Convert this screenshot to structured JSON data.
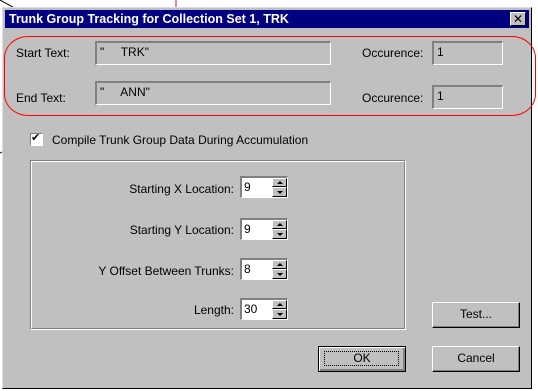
{
  "window": {
    "title": "Trunk Group Tracking for Collection Set 1, TRK",
    "close_symbol": "✕"
  },
  "start": {
    "label": "Start Text:",
    "value": "\"     TRK\"",
    "occurence_label": "Occurence:",
    "occurence_value": "1"
  },
  "end": {
    "label": "End Text:",
    "value": "\"     ANN\"",
    "occurence_label": "Occurence:",
    "occurence_value": "1"
  },
  "compile": {
    "label": "Compile Trunk Group Data During Accumulation",
    "checked": true,
    "check_symbol": "✔"
  },
  "params": [
    {
      "label": "Starting X Location:",
      "value": "9"
    },
    {
      "label": "Starting Y Location:",
      "value": "9"
    },
    {
      "label": "Y Offset Between Trunks:",
      "value": "8"
    },
    {
      "label": "Length:",
      "value": "30"
    }
  ],
  "buttons": {
    "test": "Test...",
    "ok": "OK",
    "cancel": "Cancel"
  },
  "annotation_color": "#ff0000"
}
